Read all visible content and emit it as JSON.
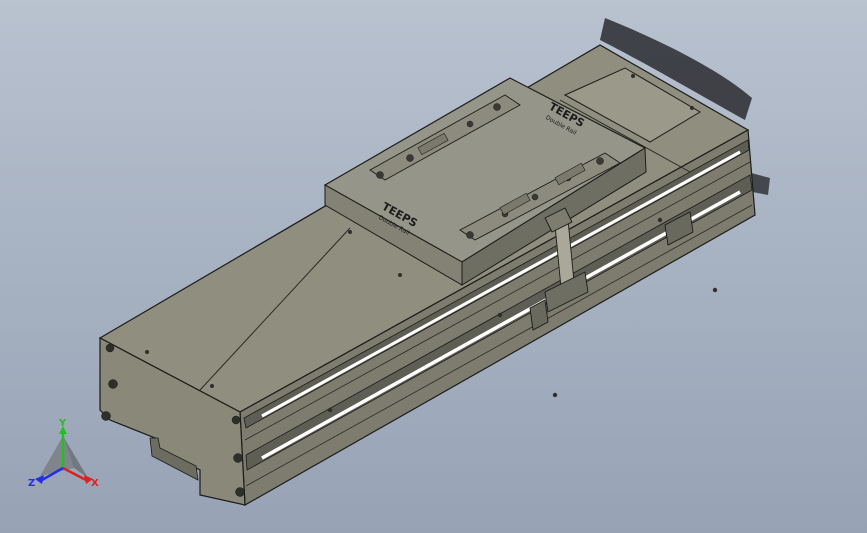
{
  "viewport": {
    "background_top": "#b9c2cf",
    "background_bottom": "#97a3b5"
  },
  "model": {
    "body_color": "#8f8e7f",
    "body_dark": "#6f6e62",
    "body_light": "#a8a796",
    "edge_color": "#1c1c1a",
    "stripe_color": "#ffffff",
    "engraving_logo_text": "TEEPS",
    "engraving_sub_text": "Double Rail"
  },
  "triad": {
    "x_label": "X",
    "y_label": "Y",
    "z_label": "Z",
    "x_color": "#e02020",
    "y_color": "#20c020",
    "z_color": "#2030e0"
  }
}
